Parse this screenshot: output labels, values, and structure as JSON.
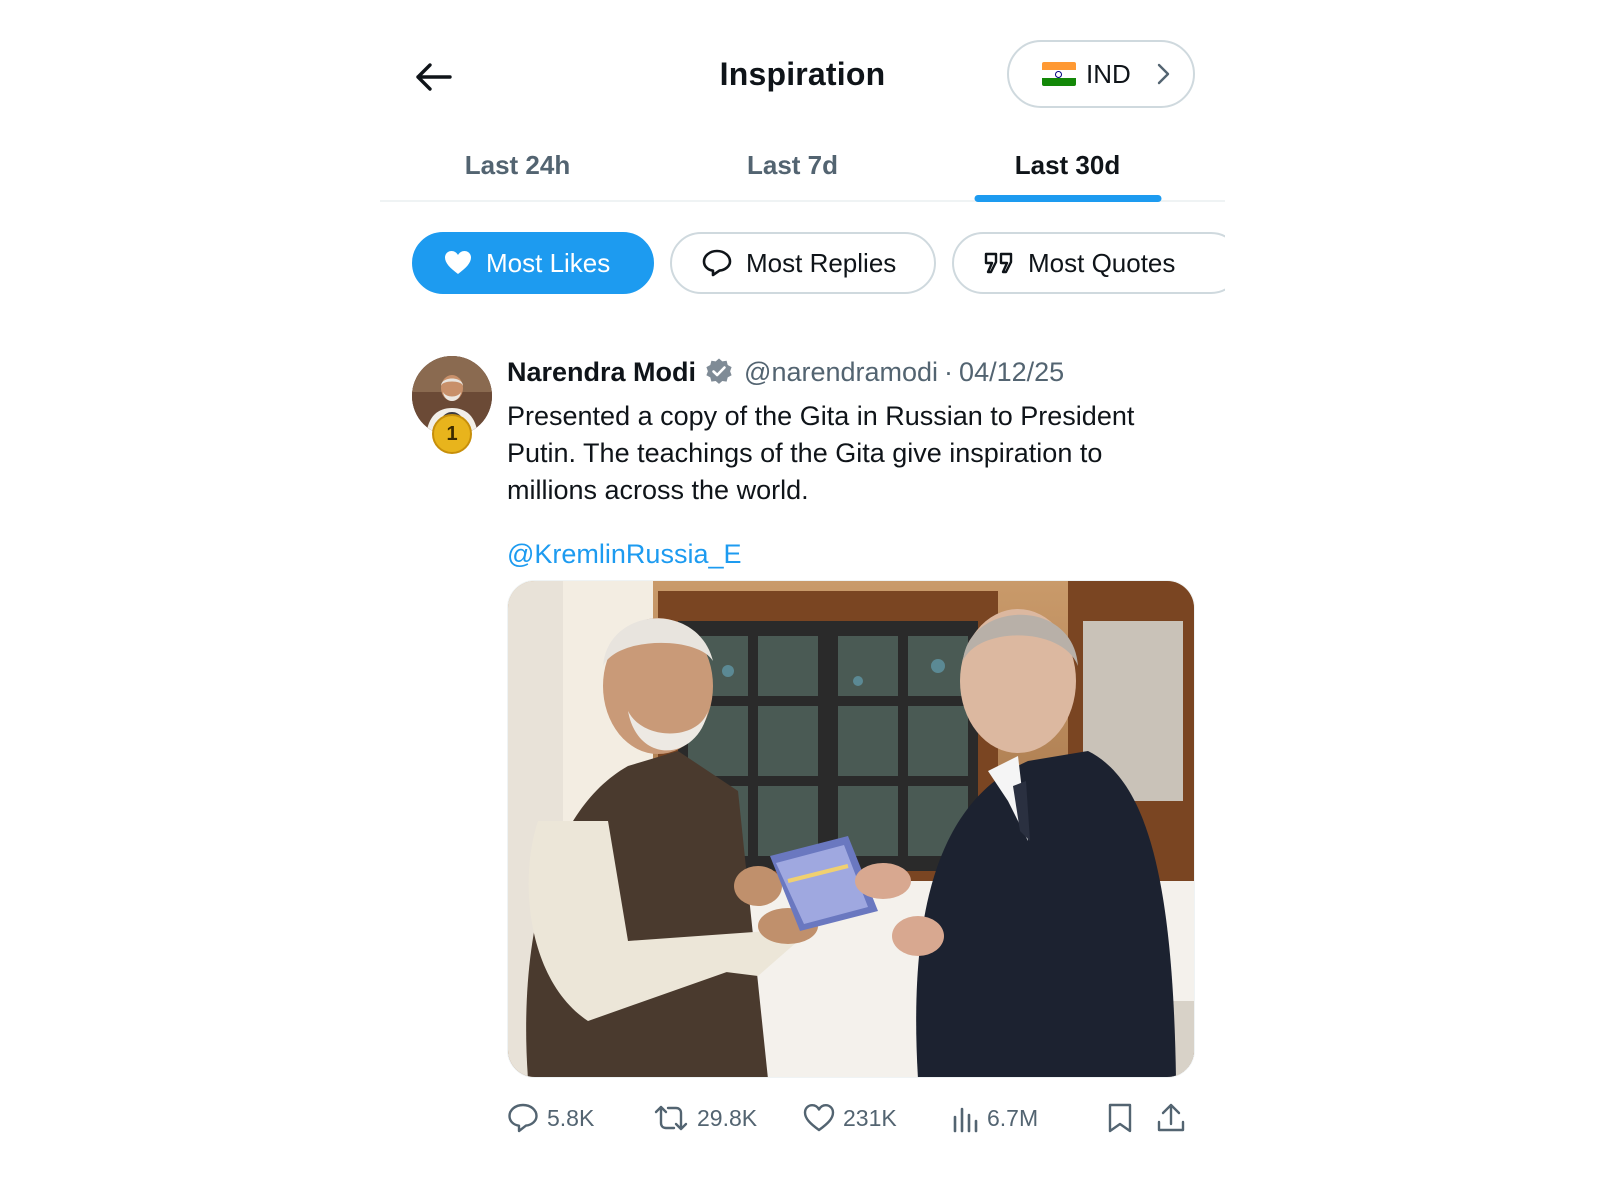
{
  "header": {
    "title": "Inspiration",
    "country": {
      "label": "IND",
      "flag_colors": [
        "#FF9933",
        "#FFFFFF",
        "#138808"
      ]
    }
  },
  "tabs": [
    {
      "label": "Last 24h",
      "active": false
    },
    {
      "label": "Last 7d",
      "active": false
    },
    {
      "label": "Last 30d",
      "active": true
    }
  ],
  "filters": [
    {
      "label": "Most Likes",
      "icon": "heart-icon",
      "active": true
    },
    {
      "label": "Most Replies",
      "icon": "reply-icon",
      "active": false
    },
    {
      "label": "Most Quotes",
      "icon": "quote-icon",
      "active": false
    }
  ],
  "post": {
    "rank": "1",
    "author_name": "Narendra Modi",
    "verified": true,
    "handle": "@narendramodi",
    "separator": "·",
    "date": "04/12/25",
    "text": "Presented a copy of the Gita in Russian to President Putin. The teachings of the Gita give inspiration to millions across the world.",
    "mention": "@KremlinRussia_E",
    "stats": {
      "replies": "5.8K",
      "reposts": "29.8K",
      "likes": "231K",
      "views": "6.7M"
    }
  },
  "colors": {
    "accent": "#1d9bf0",
    "text_primary": "#0f1419",
    "text_secondary": "#536471",
    "border": "#cfd9de",
    "badge_gold": "#e8b41c"
  }
}
